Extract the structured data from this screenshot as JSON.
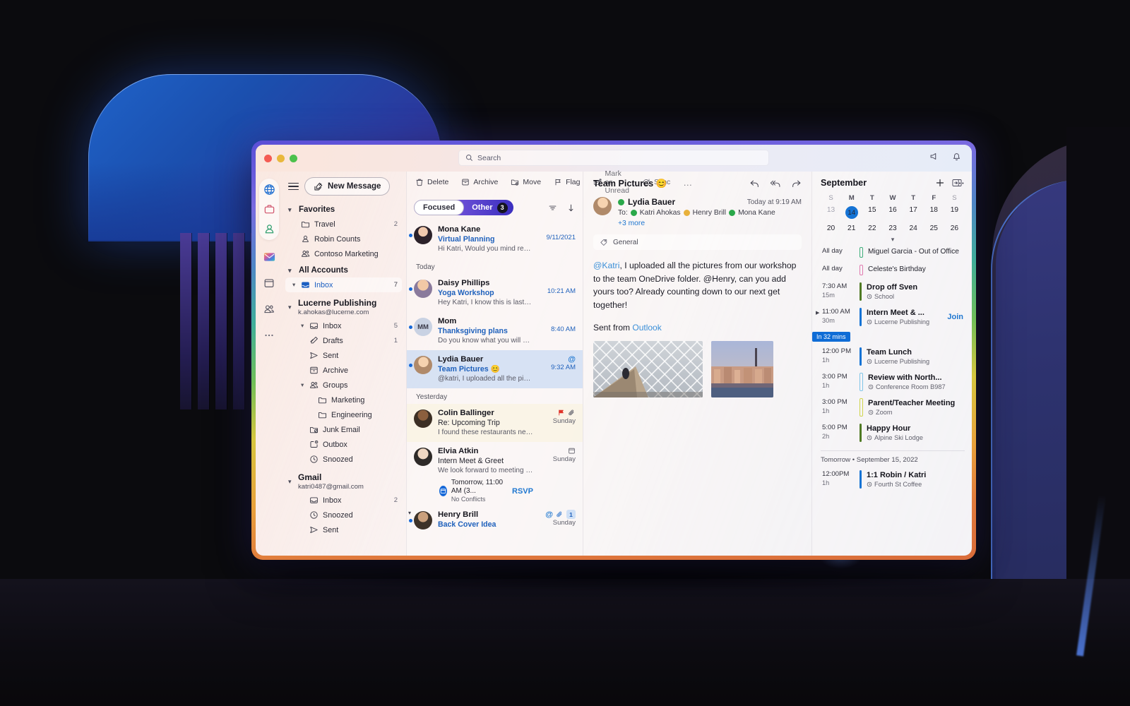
{
  "window": {
    "traffic_lights": [
      "close",
      "minimize",
      "zoom"
    ],
    "search_placeholder": "Search"
  },
  "rail": {
    "profiles": [
      {
        "name": "globe-icon",
        "label": "Globe"
      },
      {
        "name": "briefcase-icon",
        "label": "Work"
      },
      {
        "name": "person-icon",
        "label": "Personal"
      }
    ],
    "apps": [
      {
        "name": "mail-app-icon",
        "label": "Mail"
      },
      {
        "name": "calendar-app-icon",
        "label": "Calendar"
      },
      {
        "name": "people-app-icon",
        "label": "People"
      },
      {
        "name": "more-apps-icon",
        "label": "More"
      }
    ]
  },
  "toolbar": {
    "new_message": "New Message",
    "actions": [
      {
        "label": "Delete",
        "icon": "trash-icon"
      },
      {
        "label": "Archive",
        "icon": "archive-icon"
      },
      {
        "label": "Move",
        "icon": "move-icon"
      },
      {
        "label": "Flag",
        "icon": "flag-icon"
      },
      {
        "label": "Mark as Unread",
        "icon": "envelope-icon"
      },
      {
        "label": "Sync",
        "icon": "sync-icon"
      }
    ],
    "overflow": "…"
  },
  "sidebar": {
    "favorites": {
      "label": "Favorites",
      "items": [
        {
          "label": "Travel",
          "count": "2",
          "icon": "folder-icon"
        },
        {
          "label": "Robin Counts",
          "count": "",
          "icon": "person-icon"
        },
        {
          "label": "Contoso Marketing",
          "count": "",
          "icon": "people-icon"
        }
      ]
    },
    "all_accounts": {
      "label": "All Accounts",
      "items": [
        {
          "label": "Inbox",
          "count": "7",
          "icon": "inbox-icon",
          "selected": true
        }
      ]
    },
    "accounts": [
      {
        "name": "Lucerne Publishing",
        "email": "k.ahokas@lucerne.com",
        "items": [
          {
            "label": "Inbox",
            "count": "5",
            "icon": "inbox-icon",
            "expandable": true
          },
          {
            "label": "Drafts",
            "count": "1",
            "icon": "drafts-icon"
          },
          {
            "label": "Sent",
            "count": "",
            "icon": "sent-icon"
          },
          {
            "label": "Archive",
            "count": "",
            "icon": "archive-icon"
          },
          {
            "label": "Groups",
            "count": "",
            "icon": "people-icon",
            "expandable": true
          },
          {
            "label": "Marketing",
            "count": "",
            "icon": "folder-icon",
            "level": 3
          },
          {
            "label": "Engineering",
            "count": "",
            "icon": "folder-icon",
            "level": 3
          },
          {
            "label": "Junk Email",
            "count": "",
            "icon": "junk-icon"
          },
          {
            "label": "Outbox",
            "count": "",
            "icon": "outbox-icon"
          },
          {
            "label": "Snoozed",
            "count": "",
            "icon": "clock-icon"
          }
        ]
      },
      {
        "name": "Gmail",
        "email": "katri0487@gmail.com",
        "items": [
          {
            "label": "Inbox",
            "count": "2",
            "icon": "inbox-icon"
          },
          {
            "label": "Snoozed",
            "count": "",
            "icon": "clock-icon"
          },
          {
            "label": "Sent",
            "count": "",
            "icon": "sent-icon"
          }
        ]
      }
    ]
  },
  "message_list": {
    "focused_label": "Focused",
    "other_label": "Other",
    "other_count": "3",
    "filter_icon": "filter-icon",
    "sort_icon": "sort-descending-icon",
    "groups": [
      {
        "day": "",
        "messages": [
          {
            "sender": "Mona Kane",
            "subject": "Virtual Planning",
            "preview": "Hi Katri, Would you mind reading the...",
            "time": "9/11/2021",
            "unread": true,
            "avatar_type": "photo",
            "avatar_color": "#2b2129",
            "flags": []
          }
        ]
      },
      {
        "day": "Today",
        "messages": [
          {
            "sender": "Daisy Phillips",
            "subject": "Yoga Workshop",
            "preview": "Hey Katri, I know this is last minutes..",
            "time": "10:21 AM",
            "unread": true,
            "avatar_type": "photo",
            "avatar_color": "#8a7a9c",
            "flags": []
          },
          {
            "sender": "Mom",
            "subject": "Thanksgiving plans",
            "preview": "Do you know what you will be bringing...",
            "time": "8:40 AM",
            "unread": true,
            "avatar_type": "initials",
            "initials": "MM",
            "avatar_color": "#c9d2e3",
            "flags": []
          },
          {
            "sender": "Lydia Bauer",
            "subject": "Team Pictures 😊",
            "preview": "@katri, I uploaded all the pictures from...",
            "time": "9:32 AM",
            "unread": true,
            "selected": true,
            "avatar_type": "photo",
            "avatar_color": "#b08a6a",
            "flags": [
              "mention"
            ]
          }
        ]
      },
      {
        "day": "Yesterday",
        "messages": [
          {
            "sender": "Colin Ballinger",
            "subject": "Re: Upcoming Trip",
            "preview": "I found these restaurants near our hotel...",
            "time": "Sunday",
            "unread": false,
            "flagged": true,
            "avatar_type": "photo",
            "avatar_color": "#6a5344",
            "flags": [
              "flag",
              "attachment"
            ]
          },
          {
            "sender": "Elvia Atkin",
            "subject": "Intern Meet & Greet",
            "preview": "We look forward to meeting our...",
            "time": "Sunday",
            "unread": false,
            "avatar_type": "photo",
            "avatar_color": "#d8d2cc",
            "flags": [
              "calendar"
            ],
            "invite": {
              "title": "Tomorrow, 11:00 AM (3...",
              "subtitle": "No Conflicts",
              "action": "RSVP"
            }
          },
          {
            "sender": "Henry Brill",
            "subject": "Back Cover Idea",
            "preview": "",
            "time": "Sunday",
            "unread": true,
            "avatar_type": "photo",
            "avatar_color": "#5c4a3a",
            "flags": [
              "mention",
              "attachment",
              "count"
            ],
            "count": "1"
          }
        ]
      }
    ]
  },
  "reading_pane": {
    "subject": "Team Pictures 😊",
    "actions": [
      {
        "icon": "reply-icon",
        "label": "Reply"
      },
      {
        "icon": "reply-all-icon",
        "label": "Reply All"
      },
      {
        "icon": "forward-icon",
        "label": "Forward"
      }
    ],
    "from": "Lydia Bauer",
    "from_presence": "#2aa84a",
    "date": "Today at 9:19 AM",
    "to_label": "To:",
    "recipients": [
      {
        "name": "Katri Ahokas",
        "presence": "#2aa84a"
      },
      {
        "name": "Henry Brill",
        "presence": "#e8b13c"
      },
      {
        "name": "Mona Kane",
        "presence": "#2aa84a"
      }
    ],
    "more_recipients": "+3 more",
    "category": "General",
    "category_icon": "tag-icon",
    "body_mention": "@Katri",
    "body": ", I uploaded all the pictures from our workshop to the team OneDrive folder. @Henry, can you add yours too? Already counting down to our next get together!",
    "signature_prefix": "Sent from ",
    "signature_link": "Outlook",
    "attachments": [
      {
        "name": "workshop-architecture-photo"
      },
      {
        "name": "cityscape-photo"
      }
    ]
  },
  "calendar": {
    "month": "September",
    "add_icon": "plus-icon",
    "more_icon": "ellipsis-icon",
    "expand_icon": "chevron-down-icon",
    "day_labels": [
      "S",
      "M",
      "T",
      "W",
      "T",
      "F",
      "S"
    ],
    "weeks": [
      [
        {
          "n": "13",
          "dim": true
        },
        {
          "n": "14",
          "today": true
        },
        {
          "n": "15"
        },
        {
          "n": "16"
        },
        {
          "n": "17"
        },
        {
          "n": "18"
        },
        {
          "n": "19"
        }
      ],
      [
        {
          "n": "20"
        },
        {
          "n": "21"
        },
        {
          "n": "22"
        },
        {
          "n": "23"
        },
        {
          "n": "24"
        },
        {
          "n": "25"
        },
        {
          "n": "26"
        }
      ]
    ],
    "now_badge": "In 32 mins",
    "events": [
      {
        "time": "All day",
        "duration": "",
        "title": "Miguel Garcia - Out of Office",
        "location": "",
        "color": "#3fae7a",
        "hollow": true,
        "thin": true
      },
      {
        "time": "All day",
        "duration": "",
        "title": "Celeste's Birthday",
        "location": "",
        "color": "#e07ab0",
        "hollow": true,
        "thin": true
      },
      {
        "time": "7:30 AM",
        "duration": "15m",
        "title": "Drop off Sven",
        "location": "School",
        "color": "#4f7a24"
      },
      {
        "time": "11:00 AM",
        "duration": "30m",
        "title": "Intern Meet & ...",
        "location": "Lucerne Publishing",
        "color": "#1573d4",
        "join": "Join",
        "caret": true,
        "now": true
      }
    ],
    "events_after_now": [
      {
        "time": "12:00 PM",
        "duration": "1h",
        "title": "Team Lunch",
        "location": "Lucerne Publishing",
        "color": "#1573d4"
      },
      {
        "time": "3:00 PM",
        "duration": "1h",
        "title": "Review with North...",
        "location": "Conference Room B987",
        "color": "#7fc5e8",
        "hollow": true
      },
      {
        "time": "3:00 PM",
        "duration": "1h",
        "title": "Parent/Teacher Meeting",
        "location": "Zoom",
        "color": "#cfd44a",
        "hollow": true
      },
      {
        "time": "5:00 PM",
        "duration": "2h",
        "title": "Happy Hour",
        "location": "Alpine Ski Lodge",
        "color": "#4f7a24"
      }
    ],
    "tomorrow_label": "Tomorrow • September 15, 2022",
    "tomorrow_events": [
      {
        "time": "12:00PM",
        "duration": "1h",
        "title": "1:1 Robin / Katri",
        "location": "Fourth St Coffee",
        "color": "#1573d4"
      }
    ]
  },
  "titlebar_icons": [
    {
      "name": "megaphone-icon"
    },
    {
      "name": "bell-icon"
    }
  ],
  "layout_icon": {
    "name": "panel-layout-icon"
  }
}
